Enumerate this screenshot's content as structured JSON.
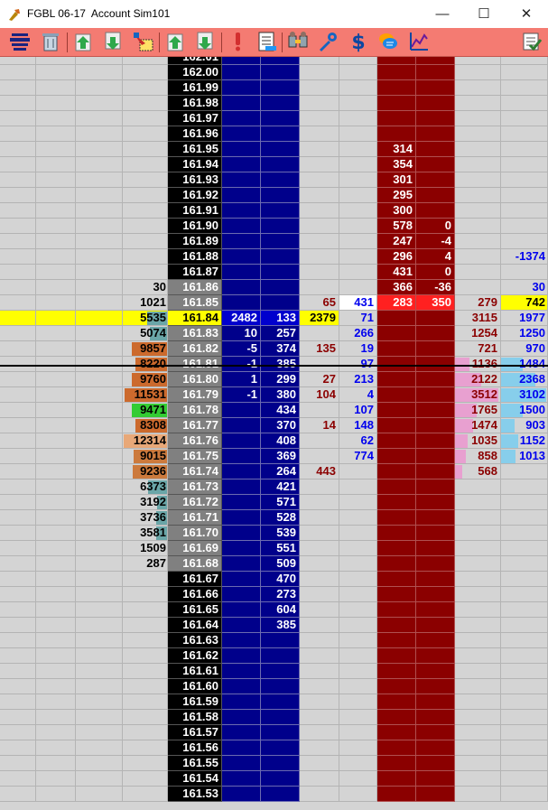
{
  "window": {
    "title": "FGBL 06-17  Account Sim101",
    "minimize": "—",
    "maximize": "☐",
    "close": "✕"
  },
  "colors": {
    "toolbar": "#f47b72",
    "price_bg": "#000000",
    "last_price_bg": "#808080",
    "bid_column": "#00008b",
    "ask_column": "#8b0000",
    "highlight": "#ffff00",
    "bid_text": "#000000",
    "sell_text": "#8b0000",
    "buy_text": "#0000ee"
  },
  "toolbar": [
    {
      "name": "center-ladder-icon"
    },
    {
      "name": "trash-icon"
    },
    {
      "name": "buy-market-icon"
    },
    {
      "name": "sell-market-icon"
    },
    {
      "name": "remove-orders-icon"
    },
    {
      "name": "buy-limit-icon"
    },
    {
      "name": "sell-limit-icon"
    },
    {
      "name": "alert-icon"
    },
    {
      "name": "order-list-icon"
    },
    {
      "name": "strategy-icon"
    },
    {
      "name": "settings-wrench-icon"
    },
    {
      "name": "dollar-icon"
    },
    {
      "name": "chat-icon"
    },
    {
      "name": "chart-icon"
    },
    {
      "name": "checklist-icon"
    }
  ],
  "ladder": {
    "rows": [
      {
        "price": "161.53"
      },
      {
        "price": "161.54"
      },
      {
        "price": "161.55"
      },
      {
        "price": "161.56"
      },
      {
        "price": "161.57"
      },
      {
        "price": "161.58"
      },
      {
        "price": "161.59"
      },
      {
        "price": "161.60"
      },
      {
        "price": "161.61"
      },
      {
        "price": "161.62"
      },
      {
        "price": "161.63"
      },
      {
        "price": "161.64",
        "bidvol": "385"
      },
      {
        "price": "161.65",
        "bidvol": "604"
      },
      {
        "price": "161.66",
        "bidvol": "273"
      },
      {
        "price": "161.67",
        "bidvol": "470"
      },
      {
        "price": "161.68",
        "bid": "287",
        "bidvol": "509",
        "price_grey": true
      },
      {
        "price": "161.69",
        "bid": "1509",
        "bidvol": "551",
        "price_grey": true
      },
      {
        "price": "161.70",
        "bid": "3581",
        "bidvol": "539",
        "bar": {
          "frac": 0.25,
          "color": "#6aa6a8"
        },
        "price_grey": true
      },
      {
        "price": "161.71",
        "bid": "3736",
        "bidvol": "528",
        "bar": {
          "frac": 0.25,
          "color": "#6aa6a8"
        },
        "price_grey": true
      },
      {
        "price": "161.72",
        "bid": "3192",
        "bidvol": "571",
        "bar": {
          "frac": 0.22,
          "color": "#6aa6a8"
        },
        "price_grey": true
      },
      {
        "price": "161.73",
        "bid": "6373",
        "bidvol": "421",
        "bar": {
          "frac": 0.43,
          "color": "#6aa6a8"
        },
        "price_grey": true
      },
      {
        "price": "161.74",
        "bid": "9236",
        "bidvol": "264",
        "sellvol": "443",
        "buytrade": "568",
        "bar": {
          "frac": 0.8,
          "color": "#cc7a3d"
        },
        "price_grey": true
      },
      {
        "price": "161.75",
        "bid": "9015",
        "bidvol": "369",
        "buyvol": "774",
        "buytrade": "858",
        "selltrade": "1013",
        "bar": {
          "frac": 0.78,
          "color": "#cc7a3d"
        },
        "price_grey": true
      },
      {
        "price": "161.76",
        "bid": "12314",
        "bidvol": "408",
        "buyvol": "62",
        "buytrade": "1035",
        "selltrade": "1152",
        "bar": {
          "frac": 1.0,
          "color": "#e8a878"
        },
        "price_grey": true
      },
      {
        "price": "161.77",
        "bid": "8308",
        "bidvol": "370",
        "sellvol": "14",
        "buyvol": "148",
        "buytrade": "1474",
        "selltrade": "903",
        "bar": {
          "frac": 0.72,
          "color": "#cc6a2d"
        },
        "price_grey": true
      },
      {
        "price": "161.78",
        "bid": "9471",
        "bidvol": "434",
        "buyvol": "107",
        "buytrade": "1765",
        "selltrade": "1500",
        "bar": {
          "frac": 0.82,
          "color": "#33cc33"
        },
        "price_grey": true
      },
      {
        "price": "161.79",
        "bid": "11531",
        "bidqty": "-1",
        "bidvol": "380",
        "sellvol": "104",
        "buyvol": "4",
        "buytrade": "3512",
        "selltrade": "3102",
        "bar": {
          "frac": 0.98,
          "color": "#cc6a2d"
        },
        "price_grey": true
      },
      {
        "price": "161.80",
        "bid": "9760",
        "bidqty": "1",
        "bidvol": "299",
        "sellvol": "27",
        "buyvol": "213",
        "buytrade": "2122",
        "selltrade": "2368",
        "bar": {
          "frac": 0.82,
          "color": "#cc6a2d"
        },
        "price_grey": true
      },
      {
        "price": "161.81",
        "bid": "8220",
        "bidqty": "-1",
        "bidvol": "385",
        "buyvol": "97",
        "buytrade": "1136",
        "selltrade": "1484",
        "bar": {
          "frac": 0.72,
          "color": "#cc6a2d"
        },
        "price_grey": true
      },
      {
        "price": "161.82",
        "bid": "9857",
        "bidqty": "-5",
        "bidvol": "374",
        "sellvol": "135",
        "buyvol": "19",
        "buytrade": "721",
        "selltrade": "970",
        "bar": {
          "frac": 0.82,
          "color": "#cc6a2d"
        },
        "price_grey": true
      },
      {
        "price": "161.83",
        "bid": "5074",
        "bidqty": "10",
        "bidvol": "257",
        "buyvol": "266",
        "buytrade": "1254",
        "selltrade": "1250",
        "bar": {
          "frac": 0.4,
          "color": "#6aa6a8"
        },
        "price_grey": true
      },
      {
        "price": "161.84",
        "bid": "5535",
        "bidqty": "2482",
        "bidvol": "133",
        "sellvol": "2379",
        "buyvol": "71",
        "buytrade": "3115",
        "selltrade": "1977",
        "bar": {
          "frac": 0.45,
          "color": "#6aa6a8"
        },
        "last": true
      },
      {
        "price": "161.85",
        "bid": "1021",
        "sellvol": "65",
        "buyvol": "431",
        "ask": "283",
        "askqty": "350",
        "buytrade": "279",
        "selltrade": "742",
        "price_grey": true,
        "ask_red": true
      },
      {
        "price": "161.86",
        "bid": "30",
        "ask": "366",
        "askqty": "-36",
        "selltrade": "30",
        "price_grey": true
      },
      {
        "price": "161.87",
        "ask": "431",
        "askqty": "0"
      },
      {
        "price": "161.88",
        "ask": "296",
        "askqty": "4",
        "selltrade": "-1374"
      },
      {
        "price": "161.89",
        "ask": "247",
        "askqty": "-4"
      },
      {
        "price": "161.90",
        "ask": "578",
        "askqty": "0"
      },
      {
        "price": "161.91",
        "ask": "300"
      },
      {
        "price": "161.92",
        "ask": "295"
      },
      {
        "price": "161.93",
        "ask": "301"
      },
      {
        "price": "161.94",
        "ask": "354"
      },
      {
        "price": "161.95",
        "ask": "314"
      },
      {
        "price": "161.96"
      },
      {
        "price": "161.97"
      },
      {
        "price": "161.98"
      },
      {
        "price": "161.99"
      },
      {
        "price": "162.00"
      },
      {
        "price": "162.01"
      }
    ]
  }
}
